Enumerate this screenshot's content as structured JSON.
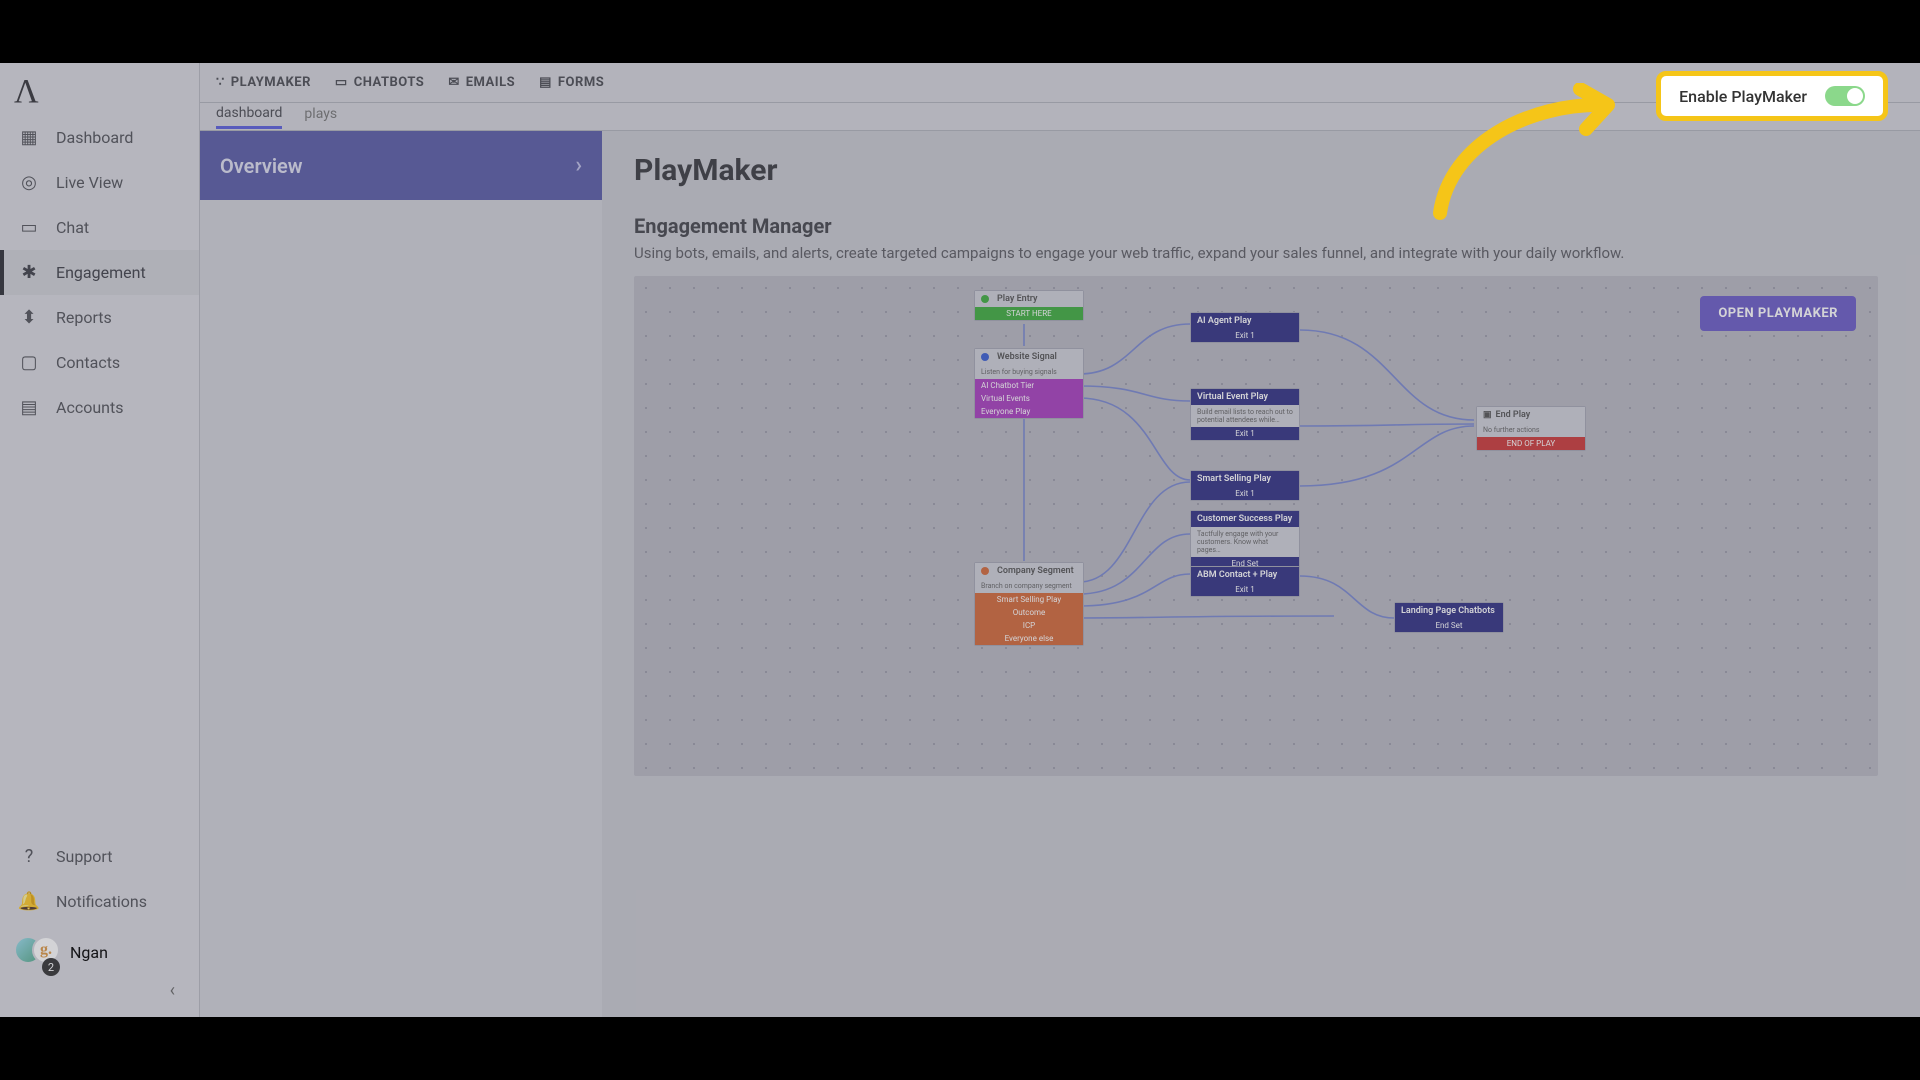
{
  "sidebar": {
    "logo_label": "Dashboard",
    "items": [
      {
        "label": "Dashboard"
      },
      {
        "label": "Live View"
      },
      {
        "label": "Chat"
      },
      {
        "label": "Engagement"
      },
      {
        "label": "Reports"
      },
      {
        "label": "Contacts"
      },
      {
        "label": "Accounts"
      }
    ],
    "support_label": "Support",
    "notifications_label": "Notifications",
    "user_name": "Ngan",
    "user_initial": "g.",
    "user_badge": "2"
  },
  "tabs": {
    "items": [
      "PLAYMAKER",
      "CHATBOTS",
      "EMAILS",
      "FORMS"
    ]
  },
  "subtabs": {
    "items": [
      "dashboard",
      "plays"
    ],
    "active": "dashboard"
  },
  "leftcol": {
    "overview_label": "Overview"
  },
  "page": {
    "title": "PlayMaker",
    "section_title": "Engagement Manager",
    "section_desc": "Using bots, emails, and alerts, create targeted campaigns to engage your web traffic, expand your sales funnel, and integrate with your daily workflow.",
    "open_button": "OPEN PLAYMAKER"
  },
  "callout": {
    "label": "Enable PlayMaker",
    "enabled": true
  },
  "diagram": {
    "play_entry": {
      "title": "Play Entry",
      "start": "START HERE"
    },
    "website_signal": {
      "title": "Website Signal",
      "desc": "Listen for buying signals",
      "rows": [
        "AI Chatbot Tier",
        "Virtual Events",
        "Everyone Play"
      ]
    },
    "company_segment": {
      "title": "Company Segment",
      "desc": "Branch on company segment",
      "rows": [
        "Smart Selling Play",
        "Outcome",
        "ICP",
        "Everyone else"
      ]
    },
    "ai_agent": {
      "title": "AI Agent Play",
      "exit": "Exit 1"
    },
    "virtual_event": {
      "title": "Virtual Event Play",
      "desc": "Build email lists to reach out to potential attendees while…",
      "exit": "Exit 1"
    },
    "smart_selling": {
      "title": "Smart Selling Play",
      "exit": "Exit 1"
    },
    "customer_success": {
      "title": "Customer Success Play",
      "desc": "Tactfully engage with your customers. Know what pages…",
      "exit": "End Set"
    },
    "abm": {
      "title": "ABM Contact + Play",
      "exit": "Exit 1"
    },
    "landing": {
      "title": "Landing Page Chatbots",
      "exit": "End Set"
    },
    "end_play": {
      "title": "End Play",
      "desc": "No further actions",
      "bar": "END OF PLAY"
    }
  }
}
